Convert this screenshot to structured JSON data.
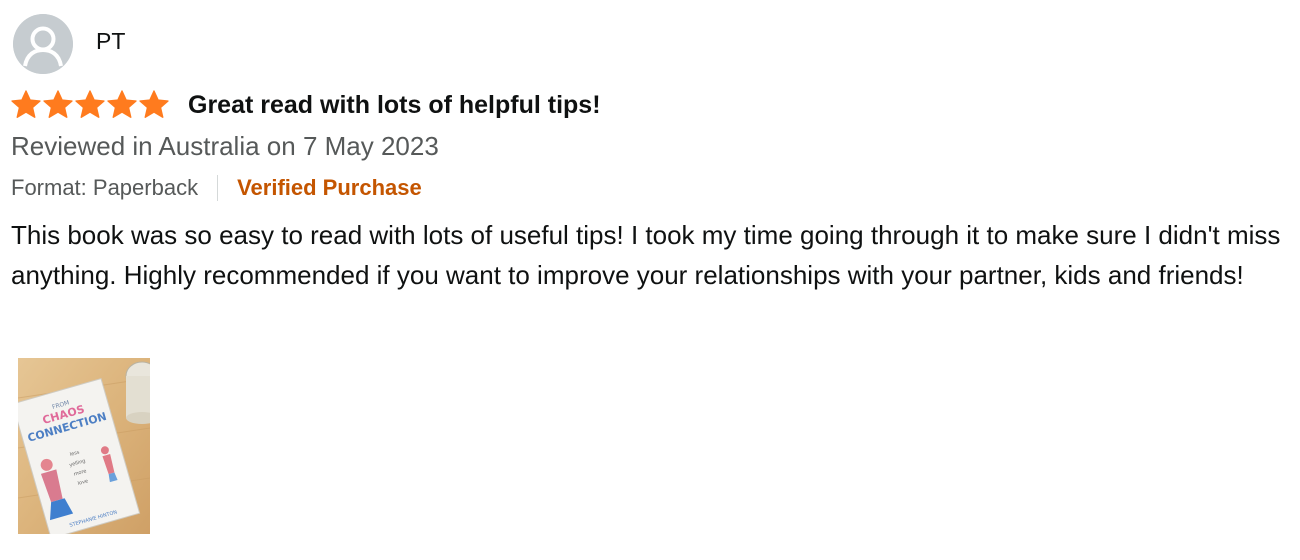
{
  "reviewer": {
    "name": "PT",
    "avatar_icon": "person-silhouette-icon"
  },
  "review": {
    "rating": 5,
    "rating_max": 5,
    "star_color": "#ff7b1e",
    "title": "Great read with lots of helpful tips!",
    "date_line": "Reviewed in Australia on 7 May 2023",
    "format": "Format: Paperback",
    "verified_label": "Verified Purchase",
    "verified_color": "#c45500",
    "body": "This book was so easy to read with lots of useful tips! I took my time going through it to make sure I didn't miss anything. Highly recommended if you want to improve your relationships with your partner, kids and friends!"
  },
  "images": [
    {
      "name": "customer-photo-book",
      "book_title_lines": [
        "CHAOS",
        "CONNECTION"
      ],
      "book_top_line": "FROM",
      "book_mid_lines": [
        "less",
        "yelling",
        "more",
        "love"
      ],
      "book_author": "STEPHANIE HINTON"
    }
  ]
}
